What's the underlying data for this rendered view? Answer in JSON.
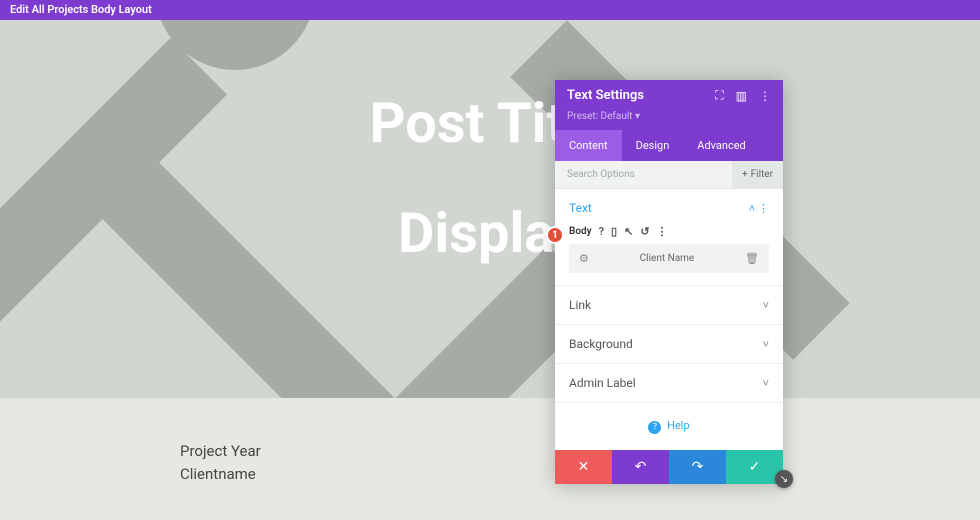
{
  "topbar": {
    "title": "Edit All Projects Body Layout"
  },
  "hero": {
    "title": "Post Title",
    "subtitle": "Display"
  },
  "content": {
    "line1": "Project Year",
    "line2": "Clientname"
  },
  "panel": {
    "title": "Text Settings",
    "preset": "Preset: Default ▾",
    "tabs": {
      "content": "Content",
      "design": "Design",
      "advanced": "Advanced"
    },
    "search": {
      "placeholder": "Search Options",
      "filter": "Filter"
    },
    "sections": {
      "text": {
        "title": "Text",
        "body_label": "Body",
        "field_name": "Client Name"
      },
      "link": {
        "title": "Link"
      },
      "background": {
        "title": "Background"
      },
      "admin": {
        "title": "Admin Label"
      }
    },
    "help": "Help"
  },
  "callout": {
    "num": "1"
  }
}
